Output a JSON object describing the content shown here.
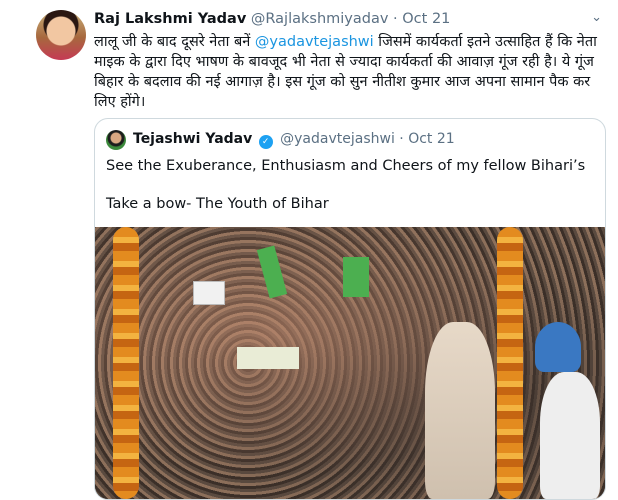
{
  "tweet": {
    "display_name": "Raj Lakshmi Yadav",
    "handle": "@Rajlakshmiyadav",
    "separator": "·",
    "date": "Oct 21",
    "text_before": "लालू जी के बाद दूसरे नेता बनें ",
    "mention": "@yadavtejashwi",
    "text_after": " जिसमें कार्यकर्ता इतने उत्साहित हैं कि नेता माइक के द्वारा दिए भाषण के बावजूद भी नेता से ज्यादा कार्यकर्ता की आवाज़ गूंज रही है। ये गूंज बिहार के बदलाव की नई आगाज़ है। इस गूंज को सुन नीतीश कुमार आज अपना सामान पैक कर लिए होंगे।",
    "more_icon": "chevron-down-icon"
  },
  "quoted_tweet": {
    "display_name": "Tejashwi Yadav",
    "handle": "@yadavtejashwi",
    "separator": "·",
    "date": "Oct 21",
    "verified_icon": "verified-badge-icon",
    "line1": "See the Exuberance, Enthusiasm and Cheers of my fellow Bihari’s",
    "line2": "Take a bow- The Youth of Bihar"
  },
  "colors": {
    "link": "#1b95e0",
    "muted": "#5b7083",
    "verified": "#1da1f2",
    "border": "#cfd9de"
  }
}
